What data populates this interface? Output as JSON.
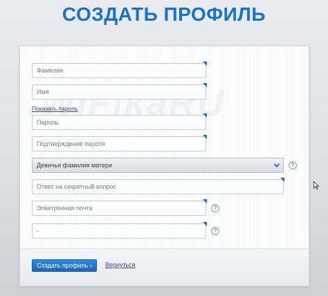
{
  "page": {
    "title": "СОЗДАТЬ ПРОФИЛЬ",
    "watermark": "WiFikaRU"
  },
  "form": {
    "last_name_placeholder": "Фамилия",
    "first_name_placeholder": "Имя",
    "show_password_label": "Показать пароль",
    "password_placeholder": "Пароль",
    "password_confirm_placeholder": "Подтверждение пароля",
    "security_question_selected": "Девичья фамилия матери",
    "security_answer_placeholder": "Ответ на секретный вопрос",
    "email_placeholder": "Электронная почта",
    "phone_placeholder": "-",
    "help_symbol": "?"
  },
  "actions": {
    "create_label": "Создать профиль  ›",
    "back_label": "Вернуться"
  },
  "colors": {
    "accent": "#1773c9",
    "button": "#1f78d1",
    "required_mark": "#1a6fd1"
  }
}
